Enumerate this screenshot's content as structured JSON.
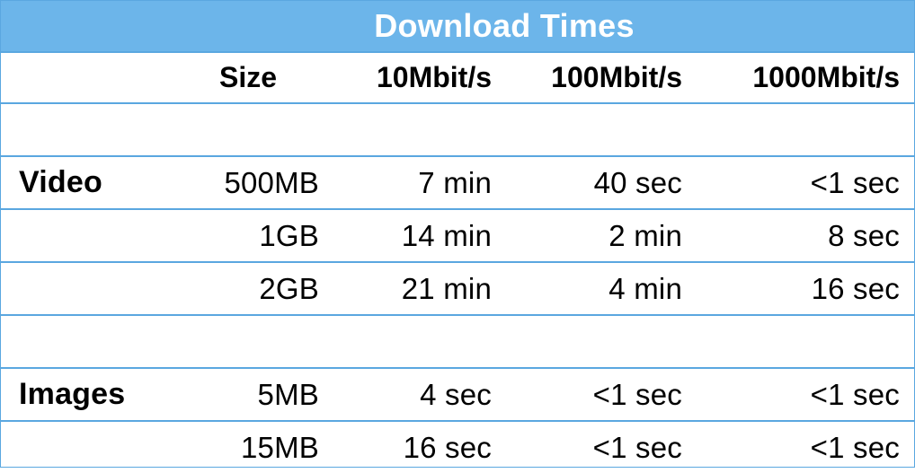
{
  "title": "Download Times",
  "columns": [
    "",
    "Size",
    "10Mbit/s",
    "100Mbit/s",
    "1000Mbit/s"
  ],
  "groups": [
    {
      "name": "Video",
      "rows": [
        {
          "size": "500MB",
          "t10": "7 min",
          "t100": "40 sec",
          "t1000": "<1 sec"
        },
        {
          "size": "1GB",
          "t10": "14 min",
          "t100": "2 min",
          "t1000": "8 sec"
        },
        {
          "size": "2GB",
          "t10": "21 min",
          "t100": "4 min",
          "t1000": "16 sec"
        }
      ]
    },
    {
      "name": "Images",
      "rows": [
        {
          "size": "5MB",
          "t10": "4 sec",
          "t100": "<1 sec",
          "t1000": "<1 sec"
        },
        {
          "size": "15MB",
          "t10": "16 sec",
          "t100": "<1 sec",
          "t1000": "<1 sec"
        }
      ]
    }
  ],
  "colors": {
    "title_background": "#6cb5ea",
    "title_text": "#ffffff",
    "rule": "#5aa7e0"
  }
}
